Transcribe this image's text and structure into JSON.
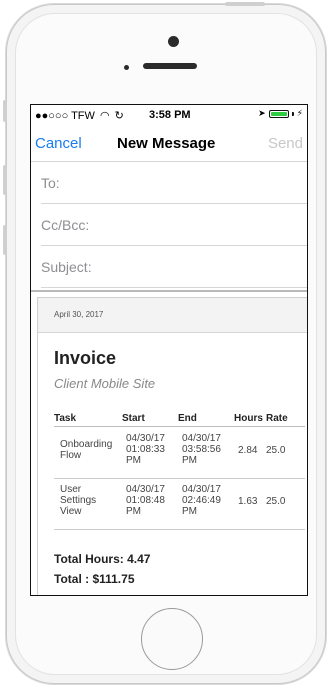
{
  "status_bar": {
    "carrier": "●●○○○ TFW",
    "time": "3:58 PM"
  },
  "nav": {
    "cancel": "Cancel",
    "title": "New Message",
    "send": "Send"
  },
  "fields": {
    "to": "To:",
    "ccbcc": "Cc/Bcc:",
    "subject": "Subject:"
  },
  "invoice": {
    "date": "April 30, 2017",
    "title": "Invoice",
    "subtitle": "Client Mobile Site",
    "columns": [
      "Task",
      "Start",
      "End",
      "Hours",
      "Rate"
    ],
    "rows": [
      {
        "task": "Onboarding Flow",
        "start": "04/30/17 01:08:33 PM",
        "end": "04/30/17 03:58:56 PM",
        "hours": "2.84",
        "rate": "25.0"
      },
      {
        "task": "User Settings View",
        "start": "04/30/17 01:08:48 PM",
        "end": "04/30/17 02:46:49 PM",
        "hours": "1.63",
        "rate": "25.0"
      }
    ],
    "total_hours": "Total Hours: 4.47",
    "total": "Total : $111.75"
  },
  "colors": {
    "accent": "#1a7cf0",
    "battery": "#2ecc40"
  }
}
